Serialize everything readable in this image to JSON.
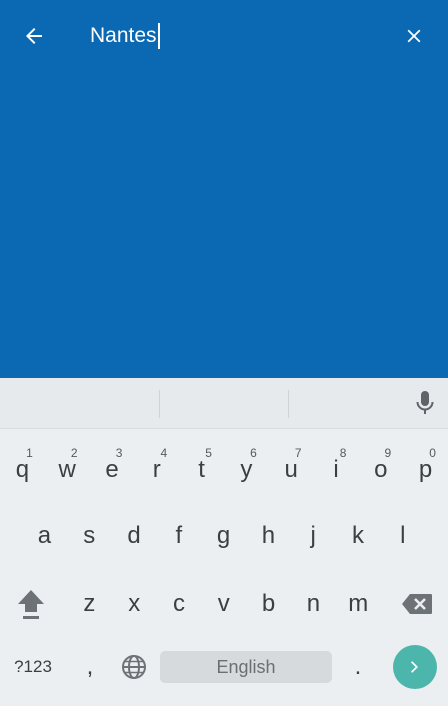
{
  "search": {
    "value": "Nantes"
  },
  "colors": {
    "app_bar": "#0b69b4",
    "keyboard_bg": "#eceff1",
    "enter_accent": "#4db6ac"
  },
  "icons": {
    "back": "arrow-left-icon",
    "close": "close-icon",
    "mic": "microphone-icon",
    "shift": "shift-icon",
    "delete": "backspace-icon",
    "globe": "globe-icon",
    "enter": "chevron-right-icon"
  },
  "keyboard": {
    "row1": [
      {
        "key": "q",
        "hint": "1"
      },
      {
        "key": "w",
        "hint": "2"
      },
      {
        "key": "e",
        "hint": "3"
      },
      {
        "key": "r",
        "hint": "4"
      },
      {
        "key": "t",
        "hint": "5"
      },
      {
        "key": "y",
        "hint": "6"
      },
      {
        "key": "u",
        "hint": "7"
      },
      {
        "key": "i",
        "hint": "8"
      },
      {
        "key": "o",
        "hint": "9"
      },
      {
        "key": "p",
        "hint": "0"
      }
    ],
    "row2": [
      "a",
      "s",
      "d",
      "f",
      "g",
      "h",
      "j",
      "k",
      "l"
    ],
    "row3": [
      "z",
      "x",
      "c",
      "v",
      "b",
      "n",
      "m"
    ],
    "symbols_label": "?123",
    "comma_label": ",",
    "space_label": "English",
    "period_label": "."
  }
}
